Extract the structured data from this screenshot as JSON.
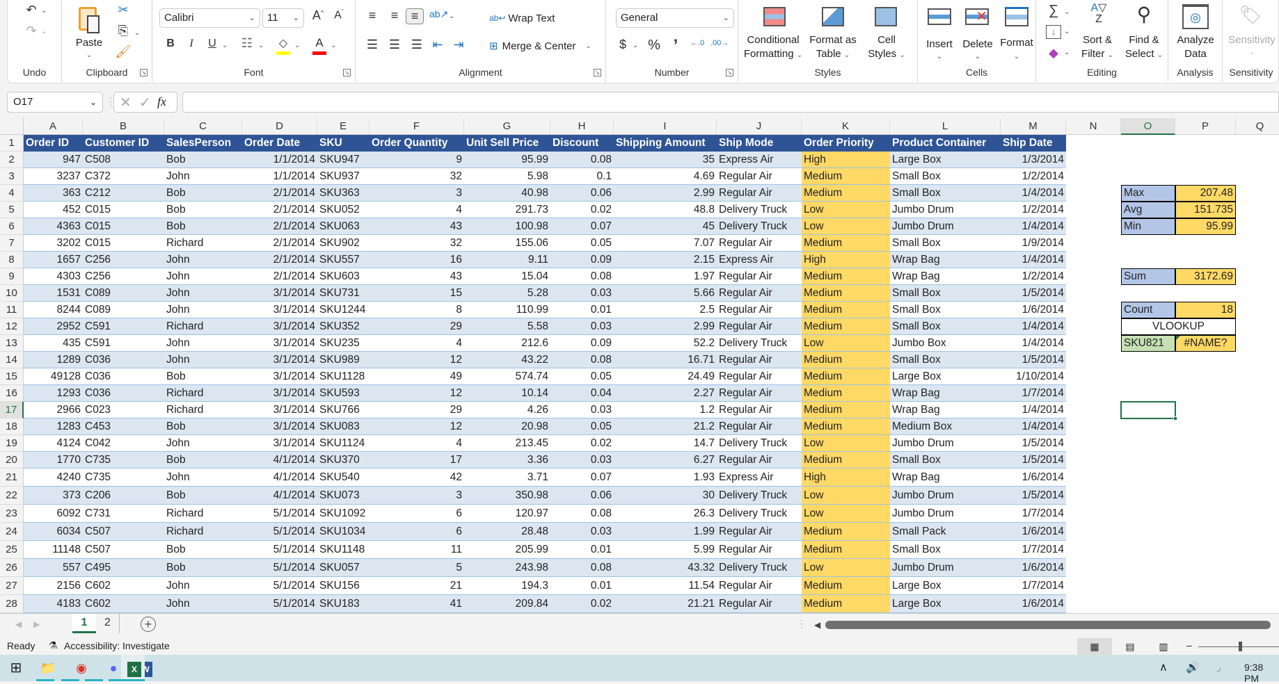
{
  "ribbon": {
    "undo_group": "Undo",
    "clipboard": {
      "label": "Clipboard",
      "paste": "Paste"
    },
    "font": {
      "label": "Font",
      "font_name": "Calibri",
      "font_size": "11",
      "bold": "B",
      "italic": "I",
      "underline": "U"
    },
    "alignment": {
      "label": "Alignment",
      "wrap_text": "Wrap Text",
      "merge_center": "Merge & Center"
    },
    "number": {
      "label": "Number",
      "format": "General",
      "currency": "$",
      "percent": "%",
      "comma": "’"
    },
    "styles": {
      "label": "Styles",
      "conditional_formatting": [
        "Conditional",
        "Formatting"
      ],
      "format_as_table": [
        "Format as",
        "Table"
      ],
      "cell_styles": [
        "Cell",
        "Styles"
      ]
    },
    "cells": {
      "label": "Cells",
      "insert": "Insert",
      "delete": "Delete",
      "format": "Format"
    },
    "editing": {
      "label": "Editing",
      "sort_filter": [
        "Sort &",
        "Filter"
      ],
      "find_select": [
        "Find &",
        "Select"
      ]
    },
    "analysis": {
      "label": "Analysis",
      "analyze_data": [
        "Analyze",
        "Data"
      ]
    },
    "sensitivity": {
      "label": "Sensitivity",
      "button": "Sensitivity"
    }
  },
  "formula_bar": {
    "name_box": "O17",
    "fx": "fx",
    "formula": ""
  },
  "columns": [
    "A",
    "B",
    "C",
    "D",
    "E",
    "F",
    "G",
    "H",
    "I",
    "J",
    "K",
    "L",
    "M",
    "N",
    "O",
    "P",
    "Q"
  ],
  "selected_column": "O",
  "selected_row": 17,
  "table": {
    "headers": [
      "Order ID",
      "Customer ID",
      "SalesPerson",
      "Order Date",
      "SKU",
      "Order Quantity",
      "Unit Sell Price",
      "Discount",
      "Shipping Amount",
      "Ship Mode",
      "Order Priority",
      "Product Container",
      "Ship Date"
    ],
    "rows": [
      [
        "947",
        "C508",
        "Bob",
        "1/1/2014",
        "SKU947",
        "9",
        "95.99",
        "0.08",
        "35",
        "Express Air",
        "High",
        "Large Box",
        "1/3/2014"
      ],
      [
        "3237",
        "C372",
        "John",
        "1/1/2014",
        "SKU937",
        "32",
        "5.98",
        "0.1",
        "4.69",
        "Regular Air",
        "Medium",
        "Small Box",
        "1/2/2014"
      ],
      [
        "363",
        "C212",
        "Bob",
        "2/1/2014",
        "SKU363",
        "3",
        "40.98",
        "0.06",
        "2.99",
        "Regular Air",
        "Medium",
        "Small Box",
        "1/4/2014"
      ],
      [
        "452",
        "C015",
        "Bob",
        "2/1/2014",
        "SKU052",
        "4",
        "291.73",
        "0.02",
        "48.8",
        "Delivery Truck",
        "Low",
        "Jumbo Drum",
        "1/2/2014"
      ],
      [
        "4363",
        "C015",
        "Bob",
        "2/1/2014",
        "SKU063",
        "43",
        "100.98",
        "0.07",
        "45",
        "Delivery Truck",
        "Low",
        "Jumbo Drum",
        "1/4/2014"
      ],
      [
        "3202",
        "C015",
        "Richard",
        "2/1/2014",
        "SKU902",
        "32",
        "155.06",
        "0.05",
        "7.07",
        "Regular Air",
        "Medium",
        "Small Box",
        "1/9/2014"
      ],
      [
        "1657",
        "C256",
        "John",
        "2/1/2014",
        "SKU557",
        "16",
        "9.11",
        "0.09",
        "2.15",
        "Express Air",
        "High",
        "Wrap Bag",
        "1/4/2014"
      ],
      [
        "4303",
        "C256",
        "John",
        "2/1/2014",
        "SKU603",
        "43",
        "15.04",
        "0.08",
        "1.97",
        "Regular Air",
        "Medium",
        "Wrap Bag",
        "1/2/2014"
      ],
      [
        "1531",
        "C089",
        "John",
        "3/1/2014",
        "SKU731",
        "15",
        "5.28",
        "0.03",
        "5.66",
        "Regular Air",
        "Medium",
        "Small Box",
        "1/5/2014"
      ],
      [
        "8244",
        "C089",
        "John",
        "3/1/2014",
        "SKU1244",
        "8",
        "110.99",
        "0.01",
        "2.5",
        "Regular Air",
        "Medium",
        "Small Box",
        "1/6/2014"
      ],
      [
        "2952",
        "C591",
        "Richard",
        "3/1/2014",
        "SKU352",
        "29",
        "5.58",
        "0.03",
        "2.99",
        "Regular Air",
        "Medium",
        "Small Box",
        "1/4/2014"
      ],
      [
        "435",
        "C591",
        "John",
        "3/1/2014",
        "SKU235",
        "4",
        "212.6",
        "0.09",
        "52.2",
        "Delivery Truck",
        "Low",
        "Jumbo Box",
        "1/4/2014"
      ],
      [
        "1289",
        "C036",
        "John",
        "3/1/2014",
        "SKU989",
        "12",
        "43.22",
        "0.08",
        "16.71",
        "Regular Air",
        "Medium",
        "Small Box",
        "1/5/2014"
      ],
      [
        "49128",
        "C036",
        "Bob",
        "3/1/2014",
        "SKU1128",
        "49",
        "574.74",
        "0.05",
        "24.49",
        "Regular Air",
        "Medium",
        "Large Box",
        "1/10/2014"
      ],
      [
        "1293",
        "C036",
        "Richard",
        "3/1/2014",
        "SKU593",
        "12",
        "10.14",
        "0.04",
        "2.27",
        "Regular Air",
        "Medium",
        "Wrap Bag",
        "1/7/2014"
      ],
      [
        "2966",
        "C023",
        "Richard",
        "3/1/2014",
        "SKU766",
        "29",
        "4.26",
        "0.03",
        "1.2",
        "Regular Air",
        "Medium",
        "Wrap Bag",
        "1/4/2014"
      ],
      [
        "1283",
        "C453",
        "Bob",
        "3/1/2014",
        "SKU083",
        "12",
        "20.98",
        "0.05",
        "21.2",
        "Regular Air",
        "Medium",
        "Medium Box",
        "1/4/2014"
      ],
      [
        "4124",
        "C042",
        "John",
        "3/1/2014",
        "SKU1124",
        "4",
        "213.45",
        "0.02",
        "14.7",
        "Delivery Truck",
        "Low",
        "Jumbo Drum",
        "1/5/2014"
      ],
      [
        "1770",
        "C735",
        "Bob",
        "4/1/2014",
        "SKU370",
        "17",
        "3.36",
        "0.03",
        "6.27",
        "Regular Air",
        "Medium",
        "Small Box",
        "1/5/2014"
      ],
      [
        "4240",
        "C735",
        "John",
        "4/1/2014",
        "SKU540",
        "42",
        "3.71",
        "0.07",
        "1.93",
        "Express Air",
        "High",
        "Wrap Bag",
        "1/6/2014"
      ],
      [
        "373",
        "C206",
        "Bob",
        "4/1/2014",
        "SKU073",
        "3",
        "350.98",
        "0.06",
        "30",
        "Delivery Truck",
        "Low",
        "Jumbo Drum",
        "1/5/2014"
      ],
      [
        "6092",
        "C731",
        "Richard",
        "5/1/2014",
        "SKU1092",
        "6",
        "120.97",
        "0.08",
        "26.3",
        "Delivery Truck",
        "Low",
        "Jumbo Drum",
        "1/7/2014"
      ],
      [
        "6034",
        "C507",
        "Richard",
        "5/1/2014",
        "SKU1034",
        "6",
        "28.48",
        "0.03",
        "1.99",
        "Regular Air",
        "Medium",
        "Small Pack",
        "1/6/2014"
      ],
      [
        "11148",
        "C507",
        "Bob",
        "5/1/2014",
        "SKU1148",
        "11",
        "205.99",
        "0.01",
        "5.99",
        "Regular Air",
        "Medium",
        "Small Box",
        "1/7/2014"
      ],
      [
        "557",
        "C495",
        "Bob",
        "5/1/2014",
        "SKU057",
        "5",
        "243.98",
        "0.08",
        "43.32",
        "Delivery Truck",
        "Low",
        "Jumbo Drum",
        "1/6/2014"
      ],
      [
        "2156",
        "C602",
        "John",
        "5/1/2014",
        "SKU156",
        "21",
        "194.3",
        "0.01",
        "11.54",
        "Regular Air",
        "Medium",
        "Large Box",
        "1/7/2014"
      ],
      [
        "4183",
        "C602",
        "John",
        "5/1/2014",
        "SKU183",
        "41",
        "209.84",
        "0.02",
        "21.21",
        "Regular Air",
        "Medium",
        "Large Box",
        "1/6/2014"
      ]
    ]
  },
  "summary": {
    "stats": [
      {
        "label": "Max",
        "value": "207.48",
        "row": 4
      },
      {
        "label": "Avg",
        "value": "151.735",
        "row": 5
      },
      {
        "label": "Min",
        "value": "95.99",
        "row": 6
      },
      {
        "label": "Sum",
        "value": "3172.69",
        "row": 9
      },
      {
        "label": "Count",
        "value": "18",
        "row": 11
      }
    ],
    "vlookup": {
      "title": "VLOOKUP",
      "key": "SKU821",
      "result": "#NAME?"
    }
  },
  "colors": {
    "header_fill": "#2f5496",
    "band_fill": "#dce6f1",
    "priority_fill": "#ffd966",
    "label_fill": "#b4c6e7",
    "key_fill": "#c6e0b4",
    "accent": "#217346"
  },
  "sheet_tabs": [
    {
      "label": "1",
      "active": true
    },
    {
      "label": "2",
      "active": false
    }
  ],
  "status": {
    "ready": "Ready",
    "accessibility": "Accessibility: Investigate"
  },
  "taskbar": {
    "time": "9:38 PM"
  }
}
